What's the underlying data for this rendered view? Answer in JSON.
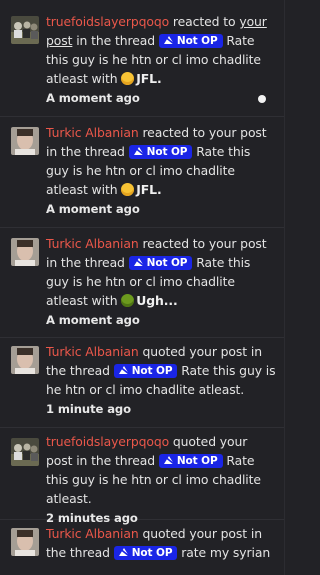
{
  "notifications": [
    {
      "user": "truefoidslayerpqoqo",
      "avatar": "avatar-group",
      "pre": " reacted to ",
      "link": "your post",
      "mid": " in the thread ",
      "badge": "Not OP",
      "thread": " Rate this guy is he htn or cl imo chadlite atleast with ",
      "reaction_emoji": "jfl-emoji",
      "reaction": "JFL.",
      "time": "A moment ago",
      "unread": true
    },
    {
      "user": "Turkic Albanian",
      "avatar": "avatar-man",
      "pre": " reacted to your post in the thread ",
      "badge": "Not OP",
      "thread": " Rate this guy is he htn or cl imo chadlite atleast with ",
      "reaction_emoji": "jfl-emoji",
      "reaction": "JFL.",
      "time": "A moment ago"
    },
    {
      "user": "Turkic Albanian",
      "avatar": "avatar-man",
      "pre": " reacted to your post in the thread ",
      "badge": "Not OP",
      "thread": " Rate this guy is he htn or cl imo chadlite atleast with ",
      "reaction_emoji": "ugh-emoji",
      "reaction": "Ugh...",
      "time": "A moment ago"
    },
    {
      "user": "Turkic Albanian",
      "avatar": "avatar-man",
      "pre": " quoted your post in the thread ",
      "badge": "Not OP",
      "thread": " Rate this guy is he htn or cl imo chadlite atleast.",
      "time": "1 minute ago"
    },
    {
      "user": "truefoidslayerpqoqo",
      "avatar": "avatar-group",
      "pre": " quoted your post in the thread ",
      "badge": "Not OP",
      "thread": " Rate this guy is he htn or cl imo chadlite atleast.",
      "time": "2 minutes ago"
    },
    {
      "user": "Turkic Albanian",
      "avatar": "avatar-man",
      "pre": " quoted your post in the thread ",
      "badge": "Not OP",
      "thread": " rate my syrian"
    }
  ],
  "colors": {
    "background": "#222226",
    "username": "#e9574a",
    "badge": "#1a25e6"
  }
}
